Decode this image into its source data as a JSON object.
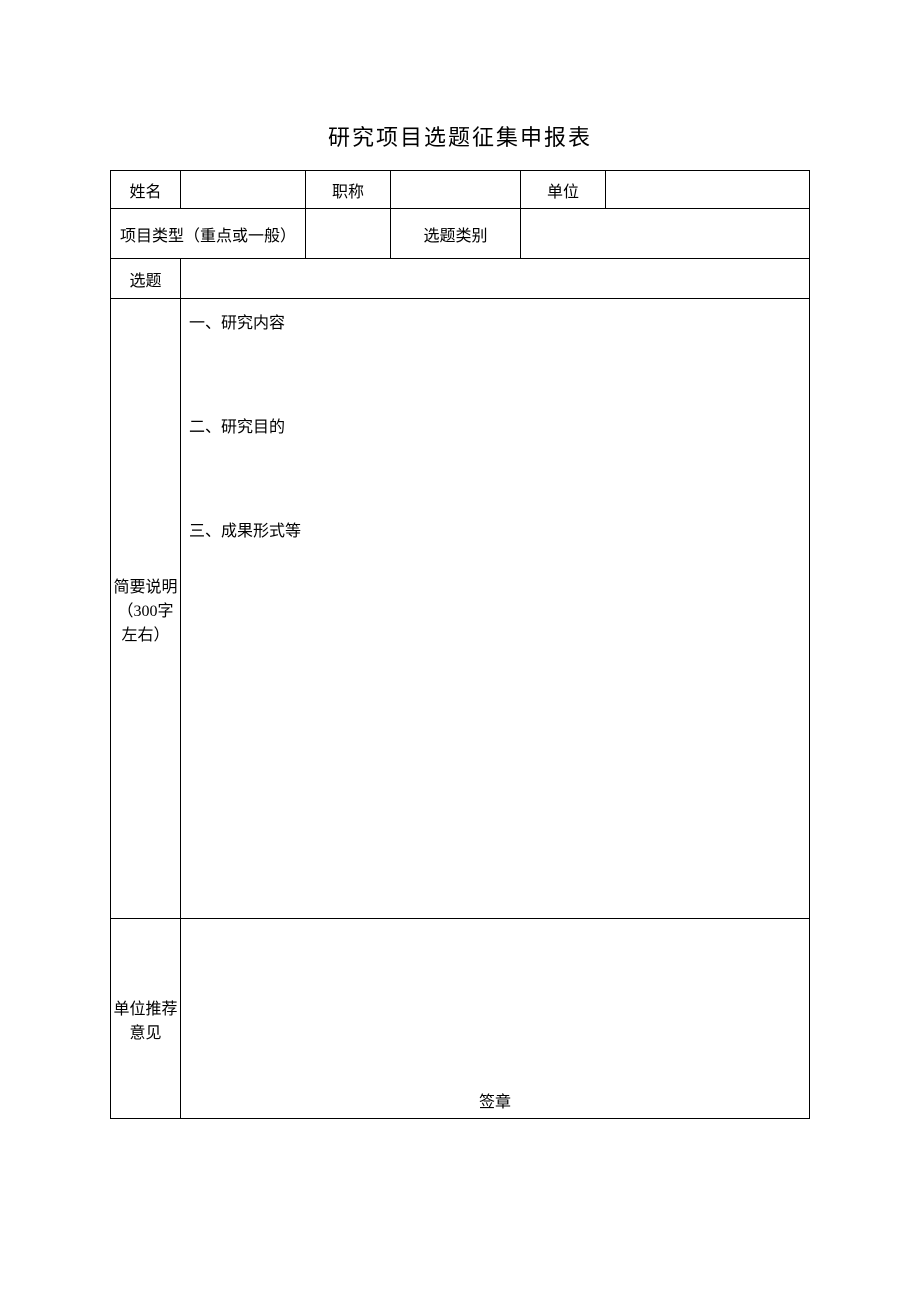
{
  "title": "研究项目选题征集申报表",
  "row1": {
    "name_label": "姓名",
    "name_value": "",
    "title_label": "职称",
    "title_value": "",
    "unit_label": "单位",
    "unit_value": ""
  },
  "row2": {
    "type_label": "项目类型（重点或一般）",
    "type_value": "",
    "category_label": "选题类别",
    "category_value": ""
  },
  "row3": {
    "topic_label": "选题",
    "topic_value": ""
  },
  "row4": {
    "desc_label": "简要说明（300字左右）",
    "section1": "一、研究内容",
    "section2": "二、研究目的",
    "section3": "三、成果形式等"
  },
  "row5": {
    "opinion_label": "单位推荐意见",
    "signature": "签章"
  }
}
